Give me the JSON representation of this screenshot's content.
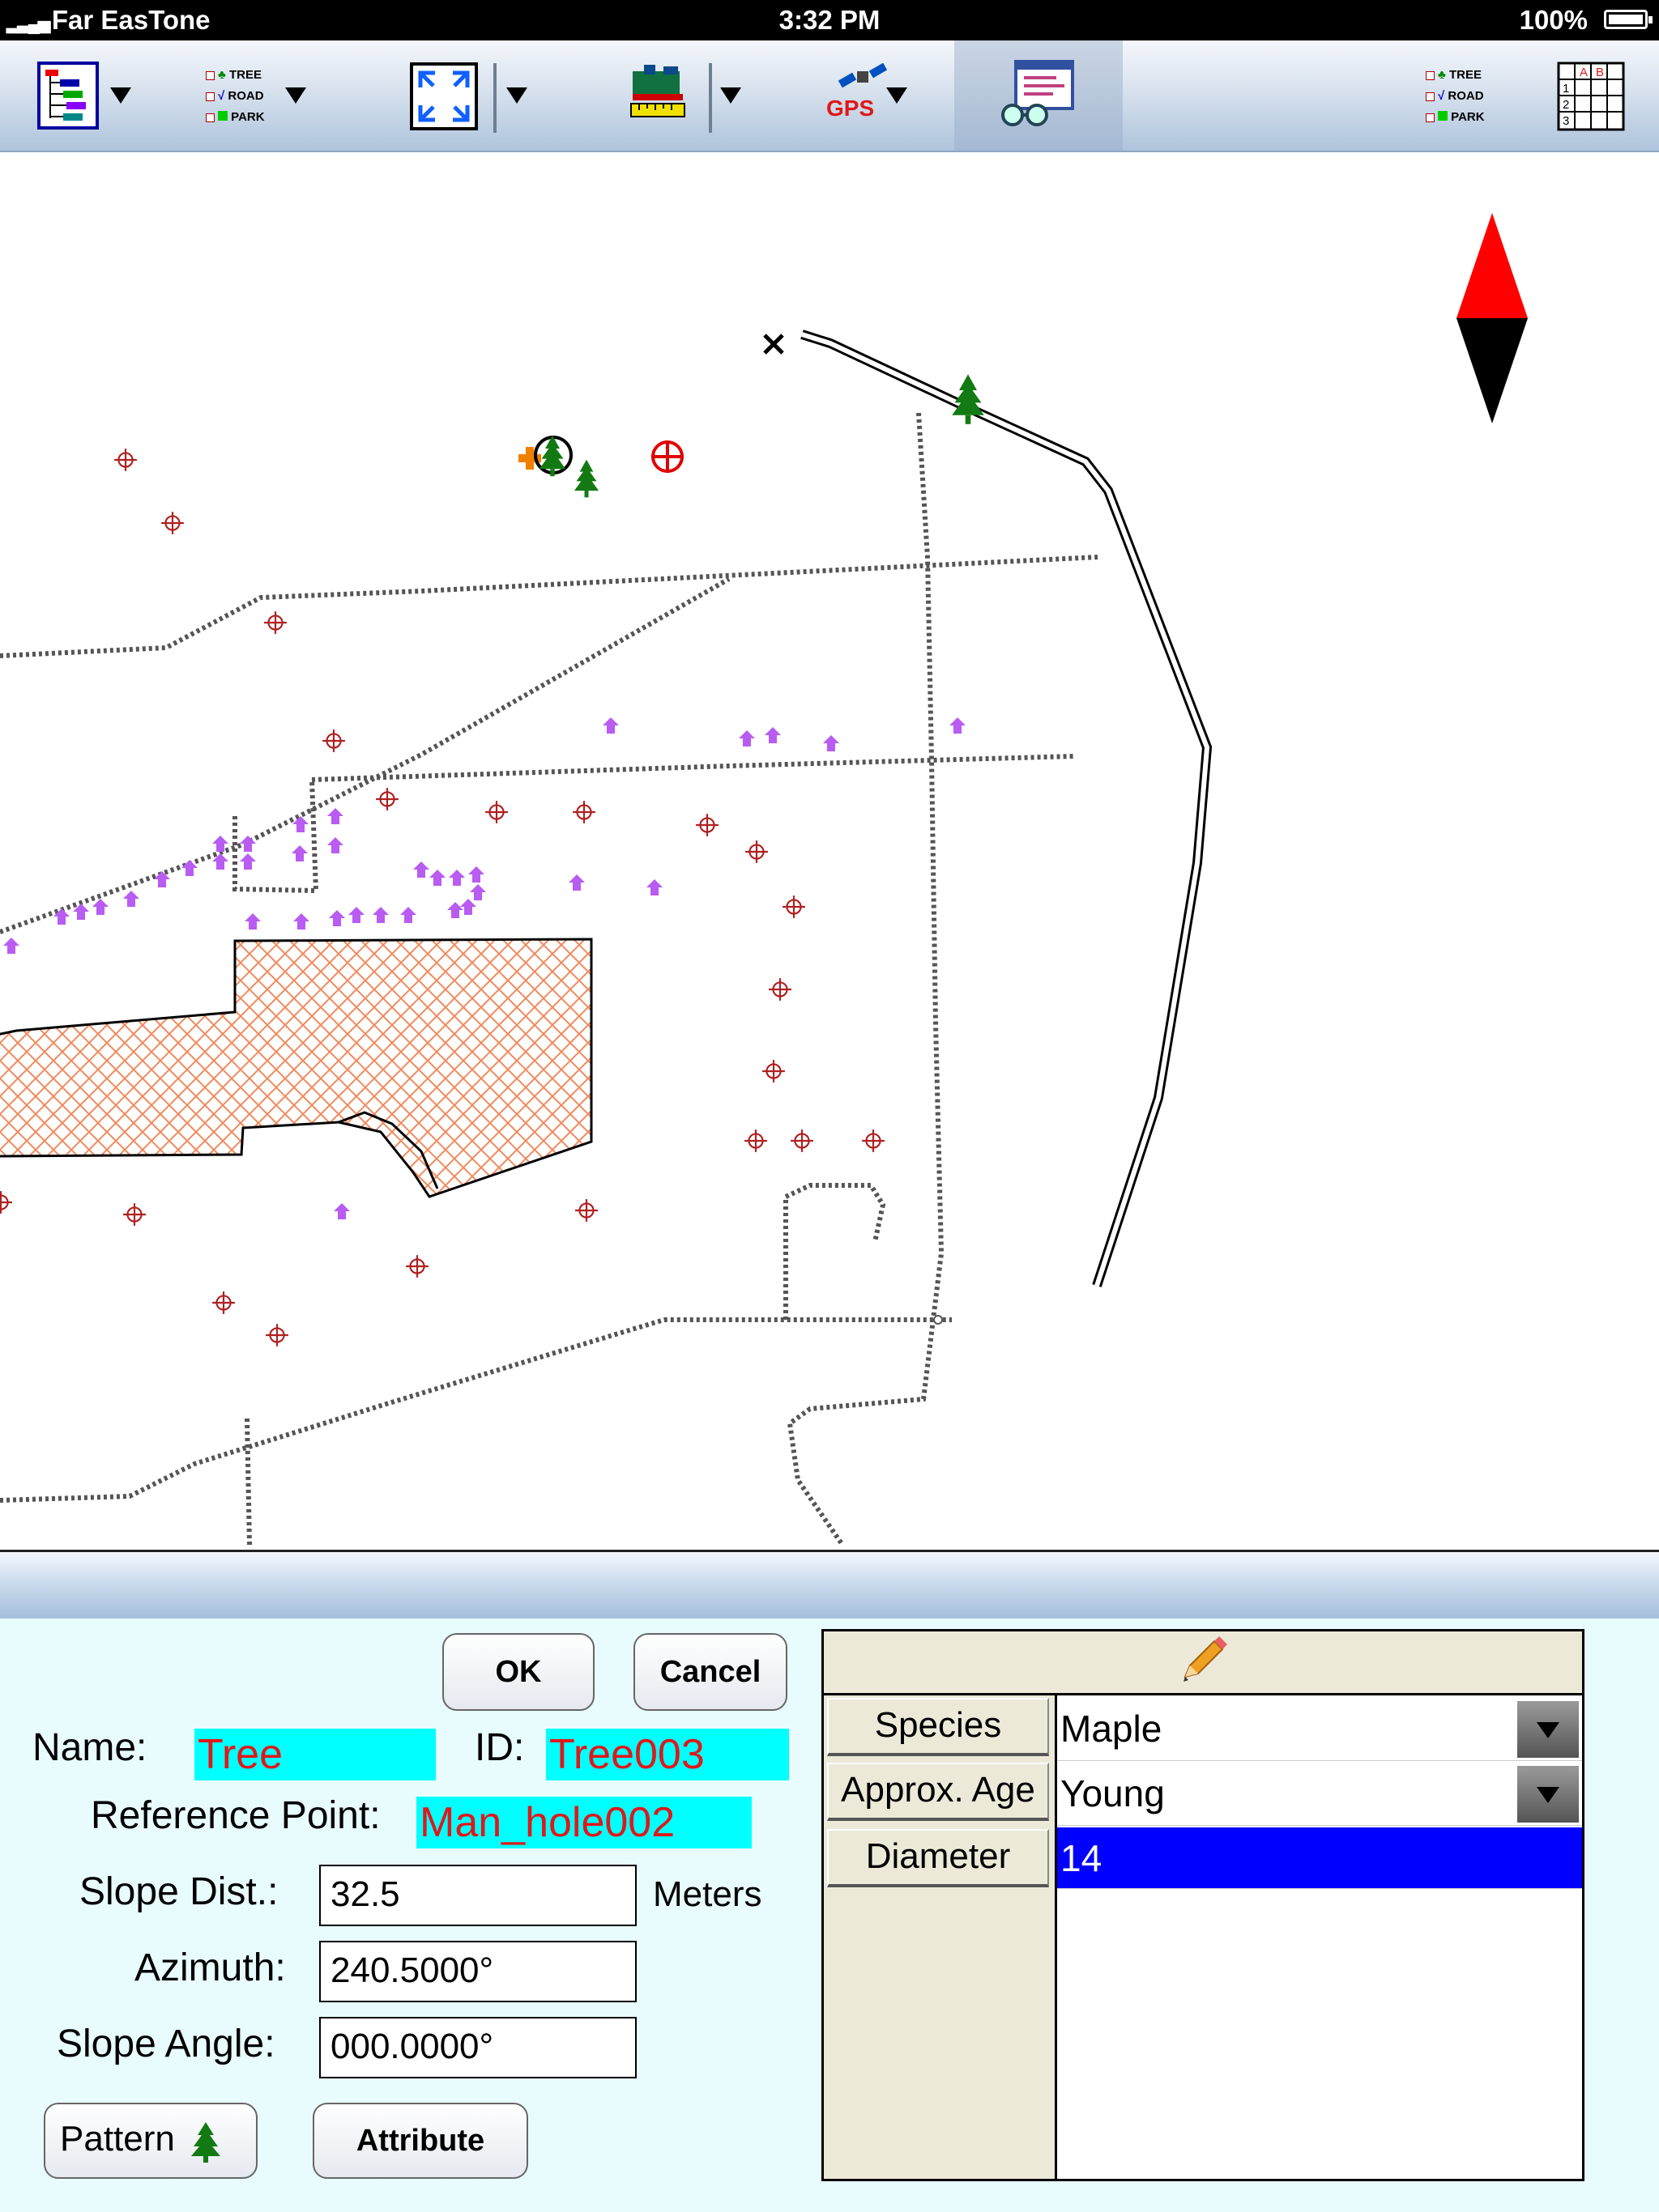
{
  "status_bar": {
    "carrier": "Far EasTone",
    "time": "3:32 PM",
    "battery": "100%"
  },
  "toolbar": {
    "legend_items": [
      "TREE",
      "ROAD",
      "PARK"
    ],
    "gps_label": "GPS",
    "grid_headers": [
      "A",
      "B"
    ],
    "grid_rows": [
      "1",
      "2",
      "3"
    ]
  },
  "colors": {
    "highlight": "#00ffff",
    "value_text": "#e01818",
    "selected_row": "#0000ff",
    "hatch": "#f08a5d"
  },
  "dialog": {
    "ok_label": "OK",
    "cancel_label": "Cancel",
    "name_label": "Name:",
    "name_value": "Tree",
    "id_label": "ID:",
    "id_value": "Tree003",
    "reference_label": "Reference Point:",
    "reference_value": "Man_hole002",
    "slope_dist_label": "Slope Dist.:",
    "slope_dist_value": "32.5",
    "slope_dist_unit": "Meters",
    "azimuth_label": "Azimuth:",
    "azimuth_value": "240.5000°",
    "slope_angle_label": "Slope Angle:",
    "slope_angle_value": "000.0000°",
    "pattern_label": "Pattern",
    "attribute_label": "Attribute"
  },
  "attributes": {
    "rows": [
      {
        "field": "Species",
        "value": "Maple"
      },
      {
        "field": "Approx. Age",
        "value": "Young"
      },
      {
        "field": "Diameter",
        "value": "14"
      }
    ]
  }
}
